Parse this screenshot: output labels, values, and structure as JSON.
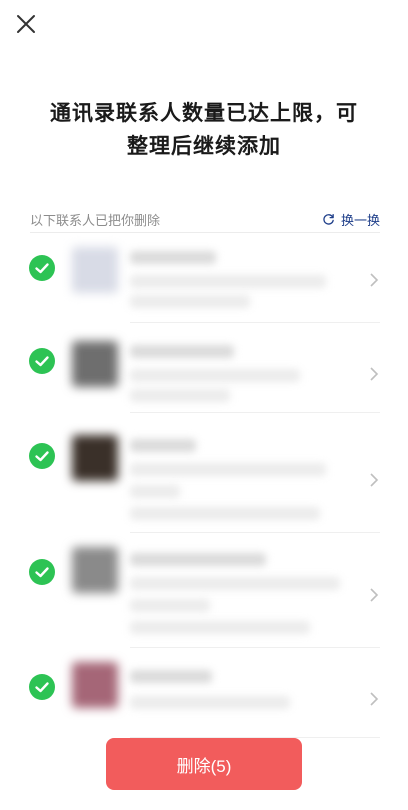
{
  "header": {
    "close_label": "close"
  },
  "title_line1": "通讯录联系人数量已达上限，可",
  "title_line2": "整理后继续添加",
  "subheader": {
    "hint": "以下联系人已把你删除",
    "refresh_label": "换一换"
  },
  "contacts": [
    {
      "selected": true,
      "avatar_color": "#d8dbe6"
    },
    {
      "selected": true,
      "avatar_color": "#6e6e6e"
    },
    {
      "selected": true,
      "avatar_color": "#3a3029"
    },
    {
      "selected": true,
      "avatar_color": "#8a8a8a"
    },
    {
      "selected": true,
      "avatar_color": "#a56677"
    }
  ],
  "delete_button": {
    "label": "删除(5)"
  },
  "colors": {
    "check": "#2dc354",
    "delete": "#f25c5c",
    "link": "#1f3f8a"
  }
}
